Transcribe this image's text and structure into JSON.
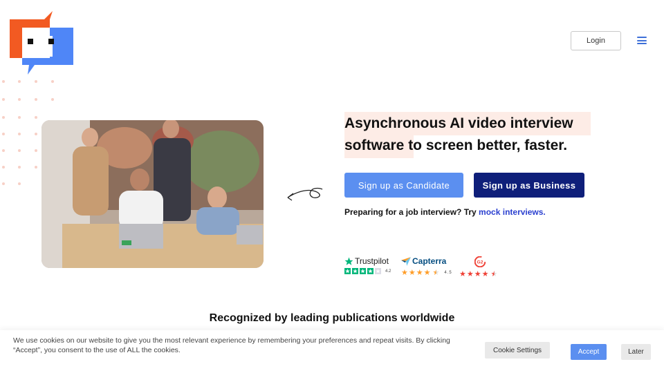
{
  "header": {
    "login_label": "Login",
    "menu_icon": "hamburger-menu-icon",
    "logo_icon": "chat-bubble-robot-logo"
  },
  "hero": {
    "headline_line1": "Asynchronous AI video interview",
    "headline_line2_highlight": "software",
    "headline_line2_rest": " to screen better, faster.",
    "candidate_button": "Sign up as Candidate",
    "business_button": "Sign up as Business",
    "prep_text": "Preparing for a job interview? Try ",
    "prep_link": "mock interviews.",
    "photo": "team-around-laptop-photo"
  },
  "ratings": [
    {
      "brand": "Trustpilot",
      "score": "4.2",
      "stars": 4.2,
      "color": "#00b67a"
    },
    {
      "brand": "Capterra",
      "score": "4.5",
      "stars": 4.5,
      "color": "#ff9d28"
    },
    {
      "brand": "G2",
      "score": "",
      "stars": 4.5,
      "color": "#ef4136"
    }
  ],
  "recognized_heading": "Recognized by leading publications worldwide",
  "cookie": {
    "text": "We use cookies on our website to give you the most relevant experience by remembering your preferences and repeat visits. By clicking “Accept”, you consent to the use of ALL the cookies.",
    "settings_label": "Cookie Settings",
    "accept_label": "Accept",
    "later_label": "Later"
  },
  "colors": {
    "accent_blue": "#5b8ff0",
    "navy": "#0f1f7a",
    "logo_orange": "#f25a22",
    "logo_blue": "#4f86f7",
    "highlight_peach": "#fdece6"
  }
}
